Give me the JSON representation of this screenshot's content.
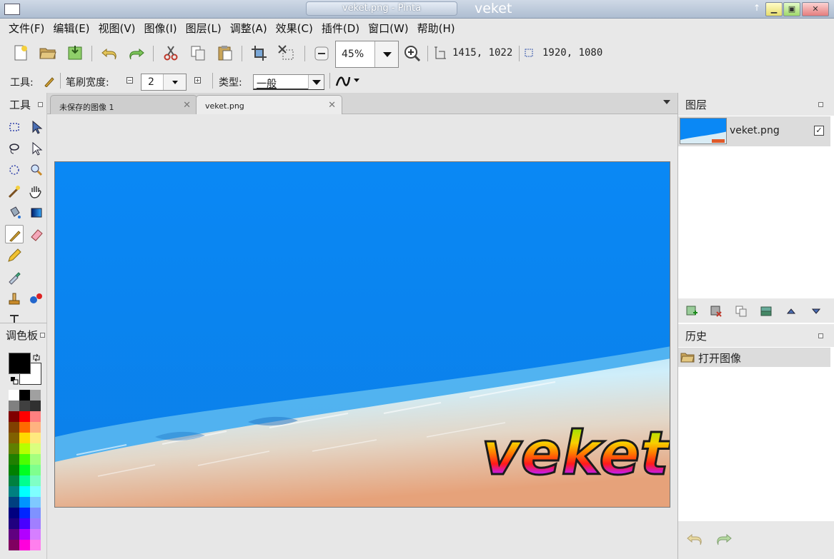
{
  "window": {
    "title": "veket.png - Pinta",
    "brand": "veket"
  },
  "menu": [
    "文件(F)",
    "编辑(E)",
    "视图(V)",
    "图像(I)",
    "图层(L)",
    "调整(A)",
    "效果(C)",
    "插件(D)",
    "窗口(W)",
    "帮助(H)"
  ],
  "toolbar": {
    "zoom_value": "45%",
    "cursor_position": "1415, 1022",
    "image_size": "1920, 1080"
  },
  "tool_options": {
    "tool_label": "工具:",
    "brush_width_label": "笔刷宽度:",
    "brush_width_value": "2",
    "type_label": "类型:",
    "type_value": "一般"
  },
  "tools_panel": {
    "title": "工具"
  },
  "palette_panel": {
    "title": "调色板",
    "primary_color": "#000000",
    "secondary_color": "#ffffff",
    "swatches": [
      [
        "#ffffff",
        "#000000",
        "#a0a0a0"
      ],
      [
        "#808080",
        "#404040",
        "#303030"
      ],
      [
        "#800000",
        "#ff0000",
        "#ff8080"
      ],
      [
        "#804000",
        "#ff6a00",
        "#ffb380"
      ],
      [
        "#806000",
        "#ffd800",
        "#ffe97f"
      ],
      [
        "#608000",
        "#b6ff00",
        "#daff7f"
      ],
      [
        "#208000",
        "#4cff00",
        "#a5ff7f"
      ],
      [
        "#008000",
        "#00ff21",
        "#7fff8e"
      ],
      [
        "#008040",
        "#00ff90",
        "#7fffc5"
      ],
      [
        "#008080",
        "#00ffff",
        "#7fffff"
      ],
      [
        "#004080",
        "#0094ff",
        "#7fc9ff"
      ],
      [
        "#000080",
        "#0026ff",
        "#7f92ff"
      ],
      [
        "#200080",
        "#4800ff",
        "#a17fff"
      ],
      [
        "#600080",
        "#b200ff",
        "#d67fff"
      ],
      [
        "#800060",
        "#ff00dc",
        "#ff7fed"
      ]
    ]
  },
  "tabs": [
    {
      "label": "未保存的图像 1",
      "active": false
    },
    {
      "label": "veket.png",
      "active": true
    }
  ],
  "image": {
    "watermark_text": "veket"
  },
  "layers_panel": {
    "title": "图层",
    "layers": [
      {
        "name": "veket.png",
        "visible": true
      }
    ]
  },
  "history_panel": {
    "title": "历史",
    "items": [
      {
        "label": "打开图像"
      }
    ]
  }
}
